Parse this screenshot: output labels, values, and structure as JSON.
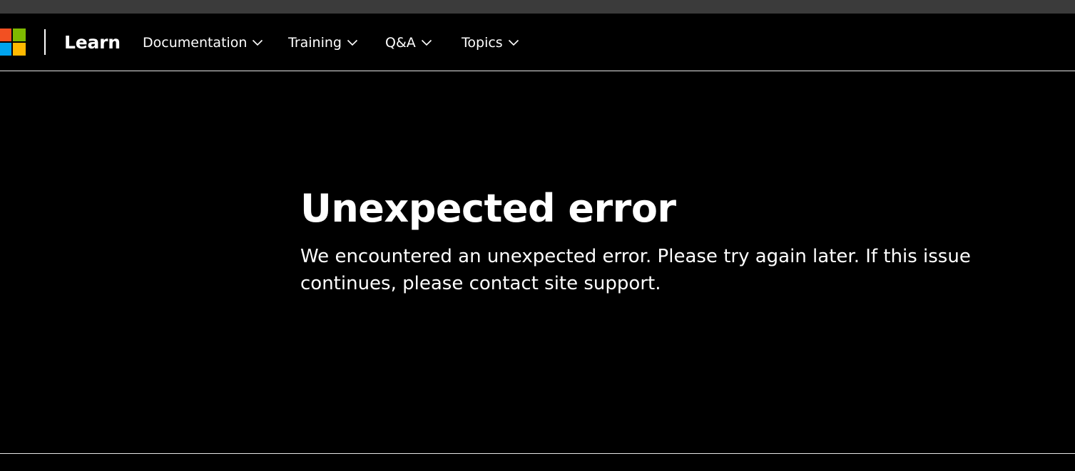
{
  "colors": {
    "page_background": "#000000",
    "text": "#ffffff",
    "top_bar": "#3b3b3b",
    "rule": "#e6e6e6",
    "logo_red": "#f25022",
    "logo_green": "#7fba00",
    "logo_blue": "#00a4ef",
    "logo_yellow": "#ffb900"
  },
  "header": {
    "logo_icon": "microsoft-logo-icon",
    "brand": "Learn",
    "nav": [
      {
        "label": "Documentation",
        "icon": "chevron-down-icon"
      },
      {
        "label": "Training",
        "icon": "chevron-down-icon"
      },
      {
        "label": "Q&A",
        "icon": "chevron-down-icon"
      },
      {
        "label": "Topics",
        "icon": "chevron-down-icon"
      }
    ]
  },
  "main": {
    "title": "Unexpected error",
    "message": "We encountered an unexpected error. Please try again later. If this issue continues, please contact site support."
  }
}
